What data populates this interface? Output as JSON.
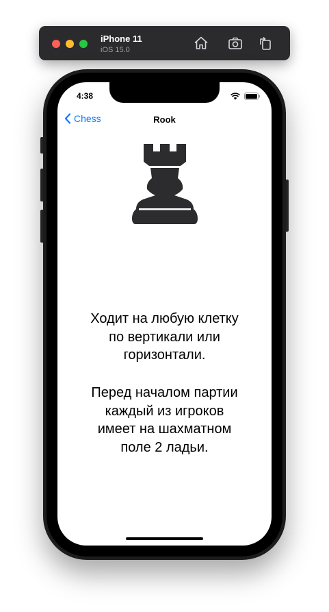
{
  "simulator": {
    "device_name": "iPhone 11",
    "os_version": "iOS 15.0",
    "buttons": [
      "home-icon",
      "screenshot-icon",
      "rotate-icon"
    ]
  },
  "status_bar": {
    "time": "4:38",
    "icons": [
      "wifi-icon",
      "battery-icon"
    ]
  },
  "nav": {
    "back_label": "Chess",
    "title": "Rook"
  },
  "content": {
    "piece_icon": "rook-icon",
    "paragraph1": "Ходит на любую клетку\nпо вертикали или\nгоризонтали.",
    "paragraph2": "Перед началом партии\nкаждый из игроков\nимеет на шахматном\nполе 2 ладьи."
  }
}
